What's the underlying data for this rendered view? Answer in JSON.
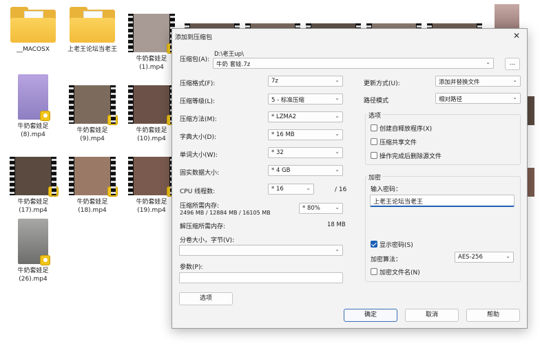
{
  "desktop": {
    "items": [
      {
        "label": "__MACOSX",
        "type": "folder"
      },
      {
        "label": "上老王论坛当老王",
        "type": "folder"
      },
      {
        "label": "牛奶套娃足(1).mp4",
        "type": "video",
        "color": "#a89a94"
      },
      {
        "label": "牛奶套娃足(8).mp4",
        "type": "video",
        "color": "#8d7fc2"
      },
      {
        "label": "牛奶套娃足(9).mp4",
        "type": "video",
        "color": "#7c6a5c"
      },
      {
        "label": "牛奶套娃足(10).mp4",
        "type": "video",
        "color": "#6b5147"
      },
      {
        "label": "牛奶套娃足(17).mp4",
        "type": "video",
        "color": "#5a4a40"
      },
      {
        "label": "牛奶套娃足(18).mp4",
        "type": "video",
        "color": "#9a7a66"
      },
      {
        "label": "牛奶套娃足(19).mp4",
        "type": "video",
        "color": "#7a5a4e"
      },
      {
        "label": "牛奶套娃足(26).mp4",
        "type": "video",
        "color": "#8a8a88"
      }
    ],
    "badge_icon": "player-badge-icon"
  },
  "dialog": {
    "title": "添加到压缩包",
    "close_icon": "close-icon",
    "archive_label": "压缩包(A):",
    "archive_path": "D:\\老王up\\",
    "archive_name": "牛奶 套娃.7z",
    "browse_label": "...",
    "format_label": "压缩格式(F):",
    "format_value": "7z",
    "level_label": "压缩等级(L):",
    "level_value": "5 - 标准压缩",
    "method_label": "压缩方法(M):",
    "method_value": "* LZMA2",
    "dict_label": "字典大小(D):",
    "dict_value": "* 16 MB",
    "word_label": "单词大小(W):",
    "word_value": "* 32",
    "solid_label": "固实数据大小:",
    "solid_value": "* 4 GB",
    "threads_label": "CPU 线程数:",
    "threads_value": "* 16",
    "threads_max": "/ 16",
    "mem_label": "压缩所需内存:",
    "mem_detail": "2496 MB / 12884 MB / 16105 MB",
    "mem_percent": "* 80%",
    "decomp_label": "解压缩所需内存:",
    "decomp_value": "18 MB",
    "split_label": "分卷大小，字节(V):",
    "split_value": "",
    "params_label": "参数(P):",
    "params_value": "",
    "options_button": "选项",
    "update_label": "更新方式(U):",
    "update_value": "添加并替换文件",
    "path_label": "路径模式",
    "path_value": "相对路径",
    "options_group": "选项",
    "opt_sfx": "创建自释放程序(X)",
    "opt_shared": "压缩共享文件",
    "opt_delete": "操作完成后删除源文件",
    "encrypt_group": "加密",
    "password_label": "输入密码：",
    "password_value": "上老王论坛当老王",
    "show_password": "显示密码(S)",
    "enc_method_label": "加密算法：",
    "enc_method_value": "AES-256",
    "enc_names": "加密文件名(N)",
    "ok": "确定",
    "cancel": "取消",
    "help": "帮助"
  }
}
